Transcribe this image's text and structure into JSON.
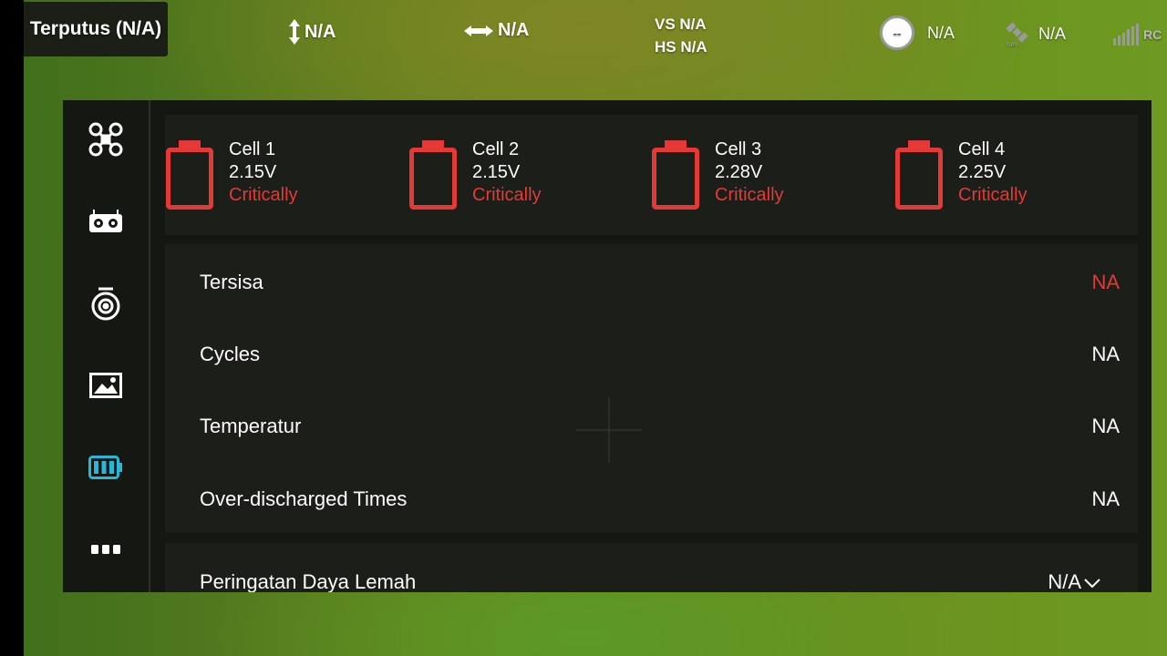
{
  "status_bar": {
    "connection": "Terputus  (N/A)",
    "altitude": "N/A",
    "distance": "N/A",
    "vs": "VS N/A",
    "hs": "HS N/A",
    "indicator_text": "--",
    "indicator_value": "N/A",
    "gps_value": "N/A",
    "rc_label": "RC"
  },
  "sidebar": {
    "items": [
      {
        "name": "aircraft",
        "icon": "drone-icon"
      },
      {
        "name": "remote-controller",
        "icon": "controller-icon"
      },
      {
        "name": "gimbal-camera",
        "icon": "camera-icon"
      },
      {
        "name": "image-transmission",
        "icon": "image-icon"
      },
      {
        "name": "battery",
        "icon": "battery-icon",
        "active": true
      },
      {
        "name": "more",
        "icon": "more-icon"
      }
    ]
  },
  "cells": [
    {
      "label": "Cell 1",
      "voltage": "2.15V",
      "status": "Critically"
    },
    {
      "label": "Cell 2",
      "voltage": "2.15V",
      "status": "Critically"
    },
    {
      "label": "Cell 3",
      "voltage": "2.28V",
      "status": "Critically"
    },
    {
      "label": "Cell 4",
      "voltage": "2.25V",
      "status": "Critically"
    }
  ],
  "battery_info": [
    {
      "label": "Tersisa",
      "value": "NA"
    },
    {
      "label": "Cycles",
      "value": "NA"
    },
    {
      "label": "Temperatur",
      "value": "NA"
    },
    {
      "label": "Over-discharged Times",
      "value": "NA"
    }
  ],
  "low_power_warning": {
    "label": "Peringatan Daya Lemah",
    "value": "N/A"
  },
  "colors": {
    "critical": "#e53935",
    "active_icon": "#29b6d8",
    "panel_bg": "#151712",
    "card_bg": "#1c1e19"
  }
}
